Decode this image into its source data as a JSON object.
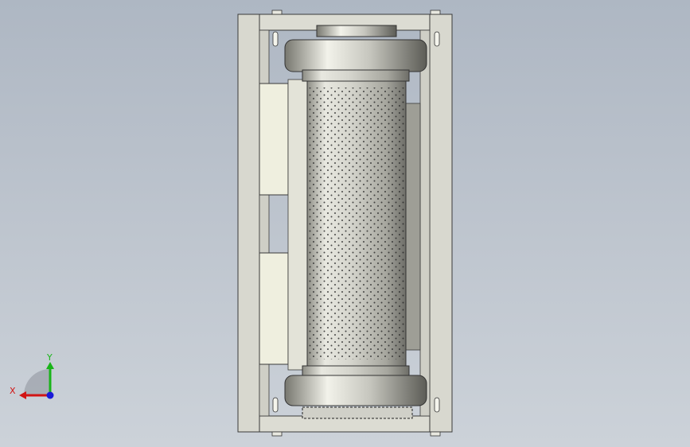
{
  "viewport": {
    "background_top": "#aeb7c3",
    "background_bottom": "#ccd2d9",
    "model": {
      "frame_color": "#d9d9d0",
      "panel_color": "#eeeede",
      "roller_color": "#c9c9bf",
      "perforation_color": "#2b2b2b",
      "edge_color": "#3a3a3a"
    }
  },
  "triad": {
    "x_label": "X",
    "y_label": "Y",
    "x_color": "#d21414",
    "y_color": "#19b419",
    "z_color": "#1a1ad8"
  }
}
